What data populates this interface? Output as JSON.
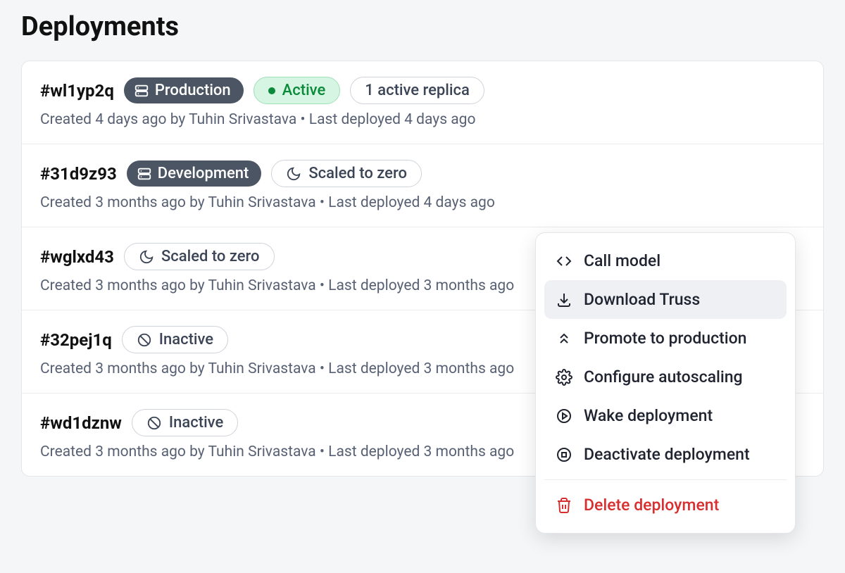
{
  "page": {
    "title": "Deployments"
  },
  "env_labels": {
    "production": "Production",
    "development": "Development"
  },
  "status_labels": {
    "active": "Active",
    "scaled_to_zero": "Scaled to zero",
    "inactive": "Inactive"
  },
  "deployments": [
    {
      "id": "#wl1yp2q",
      "env": "production",
      "status": "active",
      "replica_text": "1 active replica",
      "meta": "Created 4 days ago by Tuhin Srivastava • Last deployed 4 days ago"
    },
    {
      "id": "#31d9z93",
      "env": "development",
      "status": "scaled_to_zero",
      "meta": "Created 3 months ago by Tuhin Srivastava • Last deployed 4 days ago"
    },
    {
      "id": "#wglxd43",
      "env": null,
      "status": "scaled_to_zero",
      "meta": "Created 3 months ago by Tuhin Srivastava • Last deployed 3 months ago"
    },
    {
      "id": "#32pej1q",
      "env": null,
      "status": "inactive",
      "meta": "Created 3 months ago by Tuhin Srivastava • Last deployed 3 months ago"
    },
    {
      "id": "#wd1dznw",
      "env": null,
      "status": "inactive",
      "meta": "Created 3 months ago by Tuhin Srivastava • Last deployed 3 months ago"
    }
  ],
  "context_menu": {
    "items": [
      {
        "icon": "code-icon",
        "label": "Call model"
      },
      {
        "icon": "download-icon",
        "label": "Download Truss",
        "highlighted": true
      },
      {
        "icon": "chevrons-up-icon",
        "label": "Promote to production"
      },
      {
        "icon": "gear-icon",
        "label": "Configure autoscaling"
      },
      {
        "icon": "play-circle-icon",
        "label": "Wake deployment"
      },
      {
        "icon": "stop-circle-icon",
        "label": "Deactivate deployment"
      }
    ],
    "danger_item": {
      "icon": "trash-icon",
      "label": "Delete deployment"
    }
  }
}
